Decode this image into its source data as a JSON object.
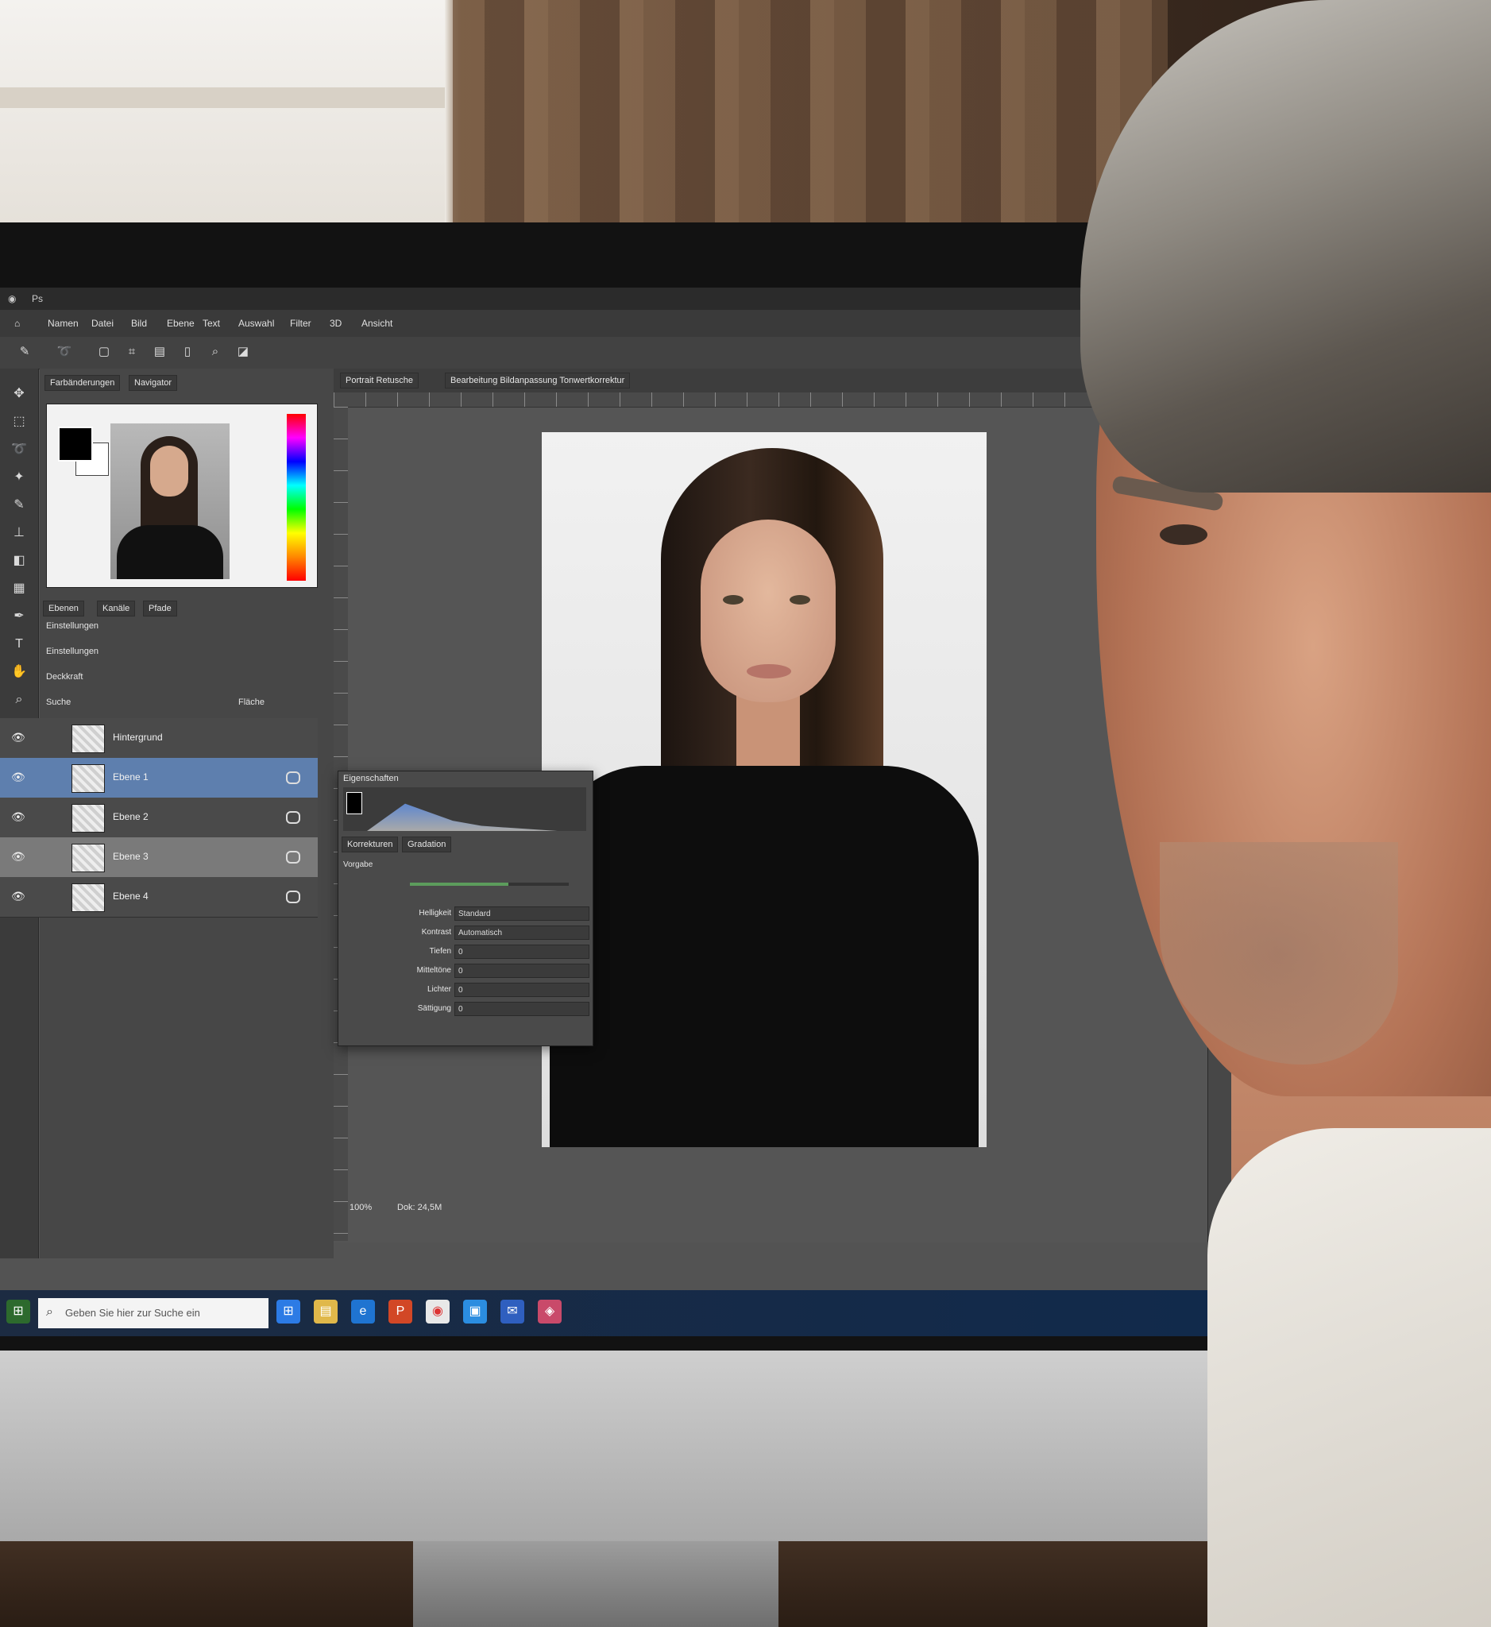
{
  "app": {
    "title": "Ps",
    "menu": [
      "Namen",
      "Datei",
      "Bild",
      "Ebene",
      "Text",
      "Auswahl",
      "Filter",
      "3D",
      "Ansicht"
    ]
  },
  "left_panel": {
    "tabs": [
      "Farbänderungen",
      "Navigator"
    ],
    "sub_tabs": [
      "Ebenen",
      "Kanäle",
      "Pfade"
    ],
    "subheading": "Einstellungen",
    "adjustments_label": "Einstellungen",
    "opacity_label": "Deckkraft",
    "fill_label": "Fläche",
    "search_label": "Suche",
    "layers": [
      {
        "name": "Hintergrund",
        "state": "normal"
      },
      {
        "name": "Ebene 1",
        "state": "selected"
      },
      {
        "name": "Ebene 2",
        "state": "normal"
      },
      {
        "name": "Ebene 3",
        "state": "hover"
      },
      {
        "name": "Ebene 4",
        "state": "normal"
      }
    ]
  },
  "document": {
    "tabs": [
      "Portrait Retusche",
      "Bearbeitung Bildanpassung Tonwertkorrektur"
    ],
    "zoom_text": "100%",
    "status_text": "Dok: 24,5M"
  },
  "properties_panel": {
    "title": "Eigenschaften",
    "tabs": [
      "Korrekturen",
      "Gradation"
    ],
    "preset_label": "Vorgabe",
    "rows": [
      {
        "label": "Helligkeit",
        "value": "Standard"
      },
      {
        "label": "Kontrast",
        "value": "Automatisch"
      },
      {
        "label": "Tiefen",
        "value": "0"
      },
      {
        "label": "Mitteltöne",
        "value": "0"
      },
      {
        "label": "Lichter",
        "value": "0"
      },
      {
        "label": "Sättigung",
        "value": "0"
      }
    ],
    "slider_value": 0.62
  },
  "taskbar": {
    "search_placeholder": "Geben Sie hier zur Suche ein",
    "icons": [
      "windows-icon",
      "explorer-icon",
      "edge-icon",
      "powerpoint-icon",
      "chrome-icon",
      "store-icon",
      "mail-icon",
      "photos-icon"
    ]
  },
  "colors": {
    "app_bg": "#535353",
    "panel_bg": "#474747",
    "selection": "#5e7fae",
    "taskbar": "#1c2b42"
  }
}
